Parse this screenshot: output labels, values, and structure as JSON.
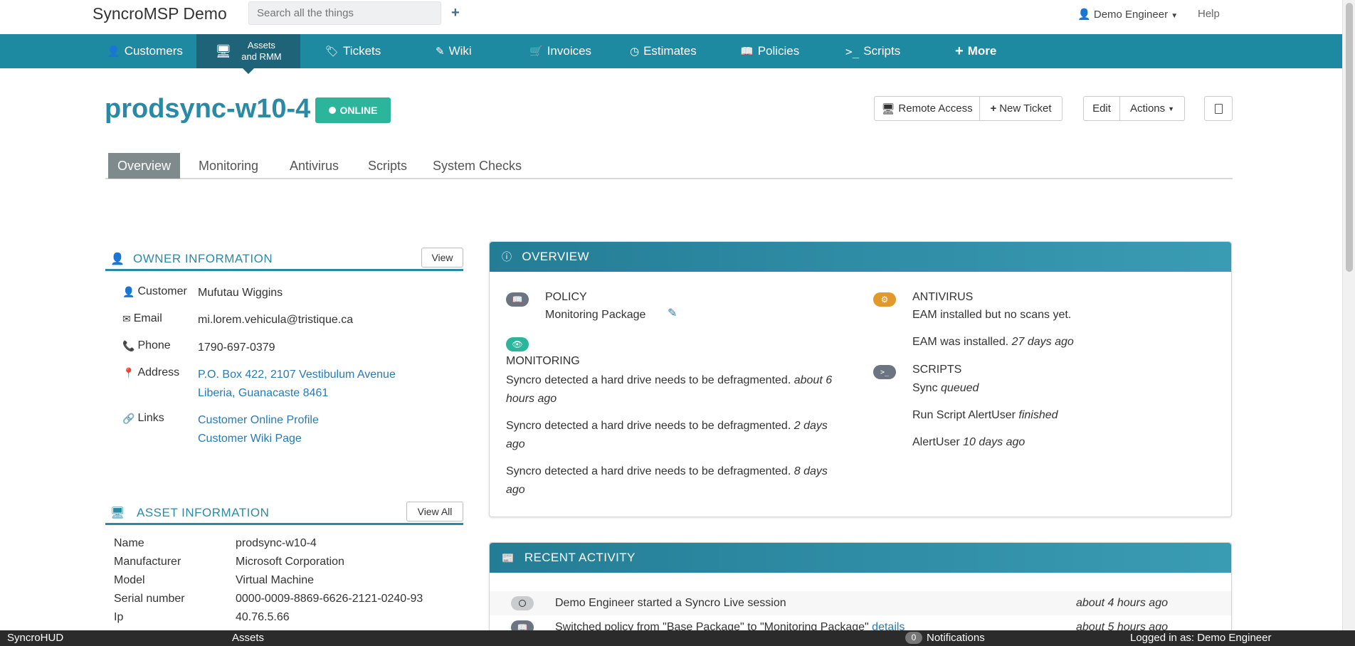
{
  "app": {
    "brand": "SyncroMSP Demo"
  },
  "search": {
    "placeholder": "Search all the things"
  },
  "topbar": {
    "user": "Demo Engineer",
    "help": "Help"
  },
  "nav": {
    "customers": "Customers",
    "assets_line1": "Assets",
    "assets_line2": "and RMM",
    "tickets": "Tickets",
    "wiki": "Wiki",
    "invoices": "Invoices",
    "estimates": "Estimates",
    "policies": "Policies",
    "scripts": "Scripts",
    "more": "More"
  },
  "asset": {
    "name": "prodsync-w10-4",
    "status": "ONLINE"
  },
  "actions": {
    "remote_access": "Remote Access",
    "new_ticket": "New Ticket",
    "edit": "Edit",
    "actions": "Actions"
  },
  "tabs": [
    "Overview",
    "Monitoring",
    "Antivirus",
    "Scripts",
    "System Checks"
  ],
  "owner": {
    "title": "OWNER INFORMATION",
    "view": "View",
    "customer_label": "Customer",
    "customer": "Mufutau Wiggins",
    "email_label": "Email",
    "email": "mi.lorem.vehicula@tristique.ca",
    "phone_label": "Phone",
    "phone": "1790-697-0379",
    "address_label": "Address",
    "address1": "P.O. Box 422, 2107 Vestibulum Avenue",
    "address2": "Liberia, Guanacaste 8461",
    "links_label": "Links",
    "link1": "Customer Online Profile",
    "link2": "Customer Wiki Page"
  },
  "asset_info": {
    "title": "ASSET INFORMATION",
    "view_all": "View All",
    "rows": [
      {
        "label": "Name",
        "value": "prodsync-w10-4"
      },
      {
        "label": "Manufacturer",
        "value": "Microsoft Corporation"
      },
      {
        "label": "Model",
        "value": "Virtual Machine"
      },
      {
        "label": "Serial number",
        "value": "0000-0009-8869-6626-2121-0240-93"
      },
      {
        "label": "Ip",
        "value": "40.76.5.66"
      }
    ]
  },
  "overview": {
    "title": "OVERVIEW",
    "policy_head": "POLICY",
    "policy_value": "Monitoring Package",
    "monitoring_head": "MONITORING",
    "monitoring": [
      {
        "text": "Syncro detected a hard drive needs to be defragmented.",
        "time": "about 6 hours ago"
      },
      {
        "text": "Syncro detected a hard drive needs to be defragmented.",
        "time": "2 days ago"
      },
      {
        "text": "Syncro detected a hard drive needs to be defragmented.",
        "time": "8 days ago"
      }
    ],
    "antivirus_head": "ANTIVIRUS",
    "antivirus1": "EAM installed but no scans yet.",
    "antivirus2_text": "EAM was installed.",
    "antivirus2_time": "27 days ago",
    "scripts_head": "SCRIPTS",
    "scripts": [
      {
        "text": "Sync",
        "status": "queued"
      },
      {
        "text": "Run Script AlertUser",
        "status": "finished"
      },
      {
        "text": "AlertUser",
        "status": "10 days ago"
      }
    ]
  },
  "recent": {
    "title": "RECENT ACTIVITY",
    "rows": [
      {
        "text": "Demo Engineer started a Syncro Live session",
        "link": "",
        "time": "about 4 hours ago"
      },
      {
        "text": "Switched policy from \"Base Package\" to \"Monitoring Package\"",
        "link": "details",
        "time": "about 5 hours ago"
      }
    ]
  },
  "bottombar": {
    "hud": "SyncroHUD",
    "assets": "Assets",
    "notif_count": "0",
    "notifications": "Notifications",
    "logged_in": "Logged in as: Demo Engineer"
  },
  "colors": {
    "nav": "#1d8aa2",
    "nav_active": "#1f6379",
    "accent": "#2a8aa6",
    "online": "#2bb59a",
    "antivirus": "#e0992a"
  }
}
